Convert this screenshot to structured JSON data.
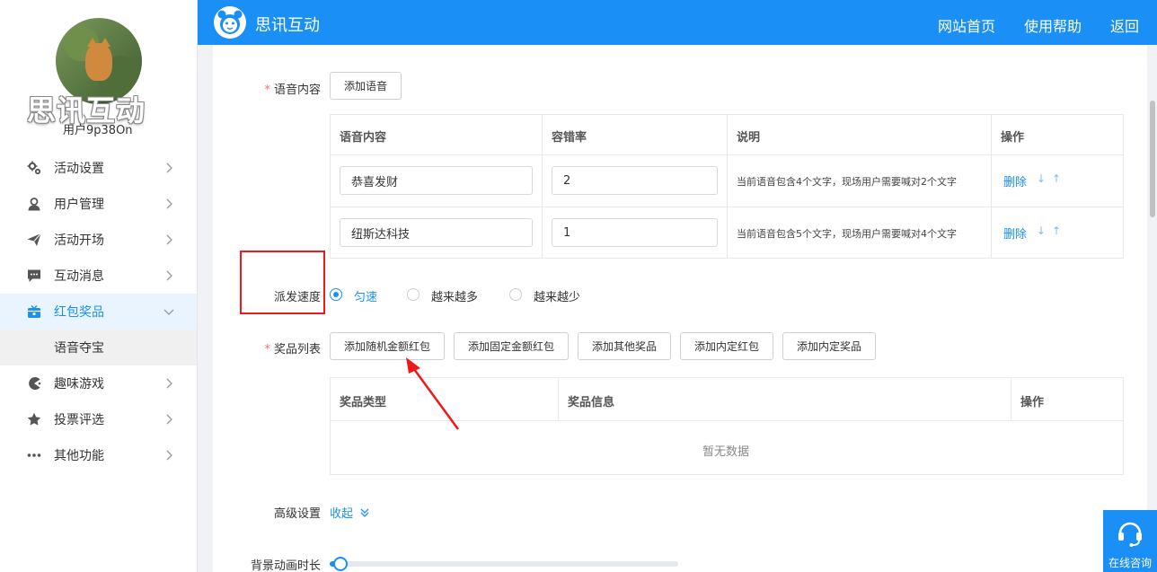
{
  "sidebar": {
    "brand_watermark": "思讯互动",
    "username": "用户9p38On",
    "items": [
      {
        "label": "活动设置",
        "icon": "gears-icon"
      },
      {
        "label": "用户管理",
        "icon": "user-icon"
      },
      {
        "label": "活动开场",
        "icon": "paper-plane-icon"
      },
      {
        "label": "互动消息",
        "icon": "chat-icon"
      },
      {
        "label": "红包奖品",
        "icon": "gift-icon",
        "active": true
      },
      {
        "label": "趣味游戏",
        "icon": "pacman-icon"
      },
      {
        "label": "投票评选",
        "icon": "star-icon"
      },
      {
        "label": "其他功能",
        "icon": "more-icon"
      }
    ],
    "submenu": {
      "label": "语音夺宝"
    }
  },
  "header": {
    "title": "思讯互动",
    "nav": [
      "网站首页",
      "使用帮助",
      "返回"
    ]
  },
  "main": {
    "voice": {
      "label": "语音内容",
      "add_button": "添加语音",
      "columns": [
        "语音内容",
        "容错率",
        "说明",
        "操作"
      ],
      "rows": [
        {
          "content": "恭喜发财",
          "tolerance": "2",
          "desc": "当前语音包含4个文字，现场用户需要喊对2个文字",
          "delete": "删除",
          "down": "↓",
          "up": "↑"
        },
        {
          "content": "纽斯达科技",
          "tolerance": "1",
          "desc": "当前语音包含5个文字，现场用户需要喊对4个文字",
          "delete": "删除",
          "down": "↓",
          "up": "↑"
        }
      ]
    },
    "speed": {
      "label": "派发速度",
      "options": [
        "匀速",
        "越来越多",
        "越来越少"
      ],
      "selected": "匀速"
    },
    "prizes": {
      "label": "奖品列表",
      "buttons": [
        "添加随机金额红包",
        "添加固定金额红包",
        "添加其他奖品",
        "添加内定红包",
        "添加内定奖品"
      ],
      "columns": [
        "奖品类型",
        "奖品信息",
        "操作"
      ],
      "empty": "暂无数据"
    },
    "advanced": {
      "label": "高级设置",
      "toggle": "收起"
    },
    "bg_anim": {
      "label": "背景动画时长",
      "value_fraction": 0.03
    }
  },
  "consult": {
    "label": "在线咨询"
  },
  "colors": {
    "primary": "#1a8ff5",
    "highlight": "#f01818",
    "required": "#f56c6c"
  }
}
